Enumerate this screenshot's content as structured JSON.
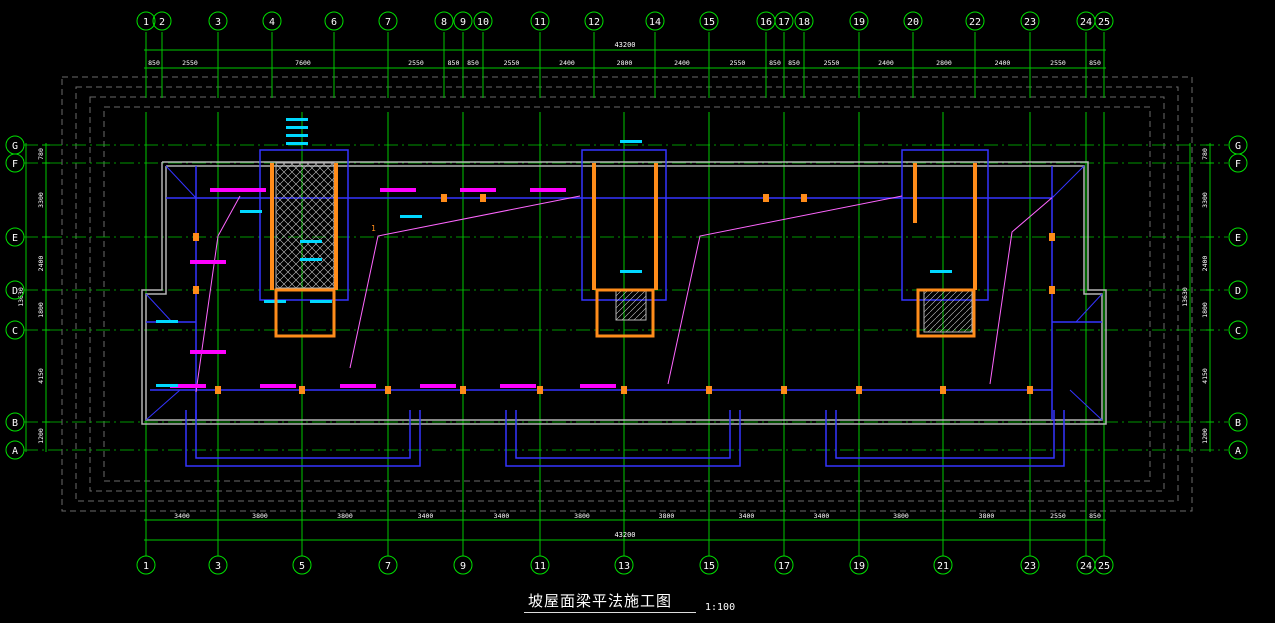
{
  "drawing": {
    "title": "坡屋面梁平法施工图",
    "scale": "1:100"
  },
  "colors": {
    "background": "#000000",
    "axis_line": "#00c800",
    "dimension": "#00c800",
    "bubble": "#00e000",
    "wall": "#b4b4b4",
    "beam": "#3434ff",
    "beam_label": "#ff00ff",
    "column": "#ff8c1a",
    "annotation": "#00d8ff",
    "hatch": "#c8c8c8",
    "outline_dash": "#6a6a6a",
    "text": "#ffffff"
  },
  "top_axes": [
    "1",
    "2",
    "3",
    "4",
    "6",
    "7",
    "8",
    "9",
    "10",
    "11",
    "12",
    "14",
    "15",
    "16",
    "17",
    "18",
    "19",
    "20",
    "22",
    "23",
    "24",
    "25"
  ],
  "top_dims": [
    "850",
    "2550",
    "7600",
    "2550",
    "850",
    "850",
    "2550",
    "2400",
    "2800",
    "2400",
    "2550",
    "850",
    "850",
    "2550",
    "2400",
    "2800",
    "2400",
    "2550",
    "850"
  ],
  "top_total": "43200",
  "bottom_axes": [
    "1",
    "3",
    "5",
    "7",
    "9",
    "11",
    "13",
    "15",
    "17",
    "19",
    "21",
    "23",
    "24",
    "25"
  ],
  "bottom_dims": [
    "3400",
    "3800",
    "3800",
    "3400",
    "3400",
    "3800",
    "3800",
    "3400",
    "3400",
    "3800",
    "3800",
    "2550",
    "850"
  ],
  "bottom_total": "43200",
  "row_axes": [
    "G",
    "F",
    "E",
    "D",
    "C",
    "B",
    "A"
  ],
  "left_dims": [
    "780",
    "3300",
    "2400",
    "1800",
    "4150",
    "1200"
  ],
  "right_dims": [
    "780",
    "3300",
    "2400",
    "1800",
    "4150",
    "1200"
  ],
  "side_total": "13630",
  "small_mark": "1"
}
